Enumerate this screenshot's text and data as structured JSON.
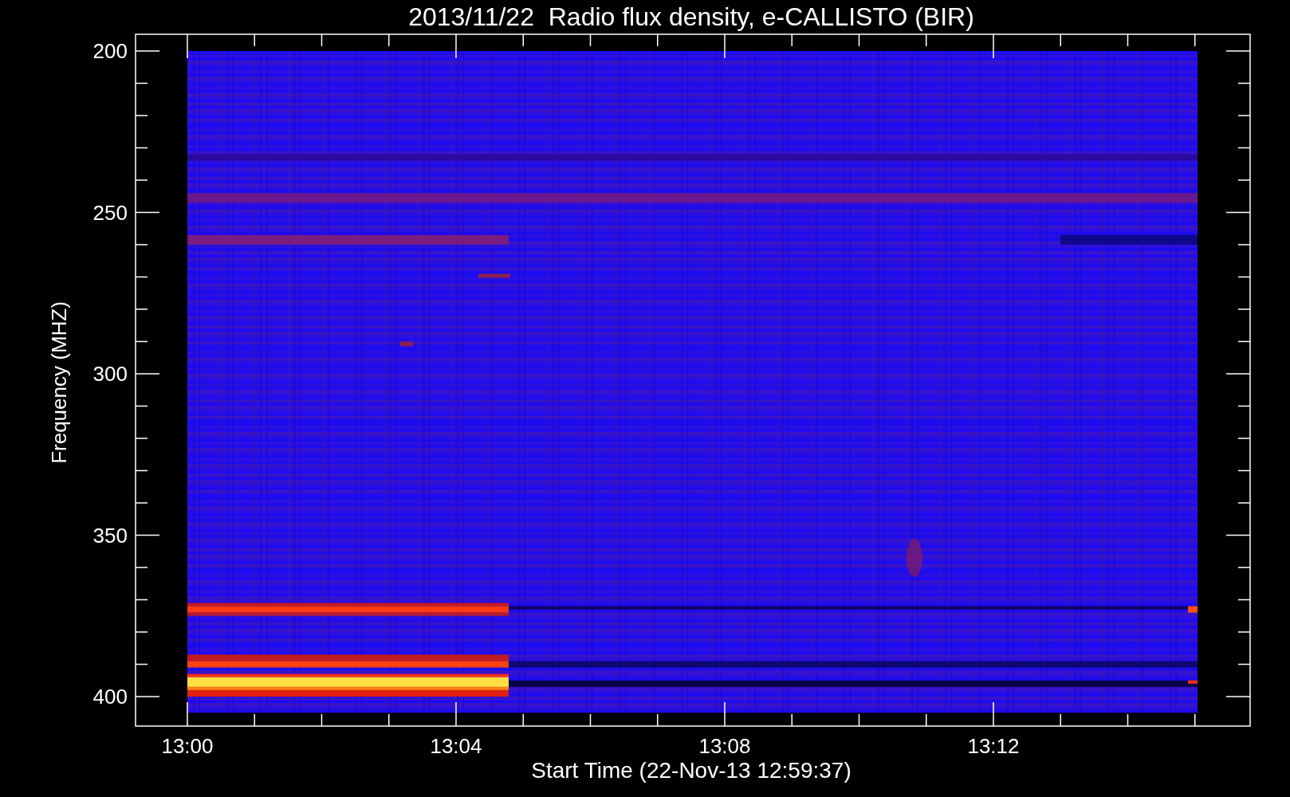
{
  "title": "2013/11/22  Radio flux density, e-CALLISTO (BIR)",
  "y_axis": {
    "label": "Frequency (MHZ)",
    "ticks": [
      "200",
      "250",
      "300",
      "350",
      "400"
    ]
  },
  "x_axis": {
    "label": "Start Time (22-Nov-13 12:59:37)",
    "ticks": [
      "13:00",
      "13:04",
      "13:08",
      "13:12"
    ]
  }
}
